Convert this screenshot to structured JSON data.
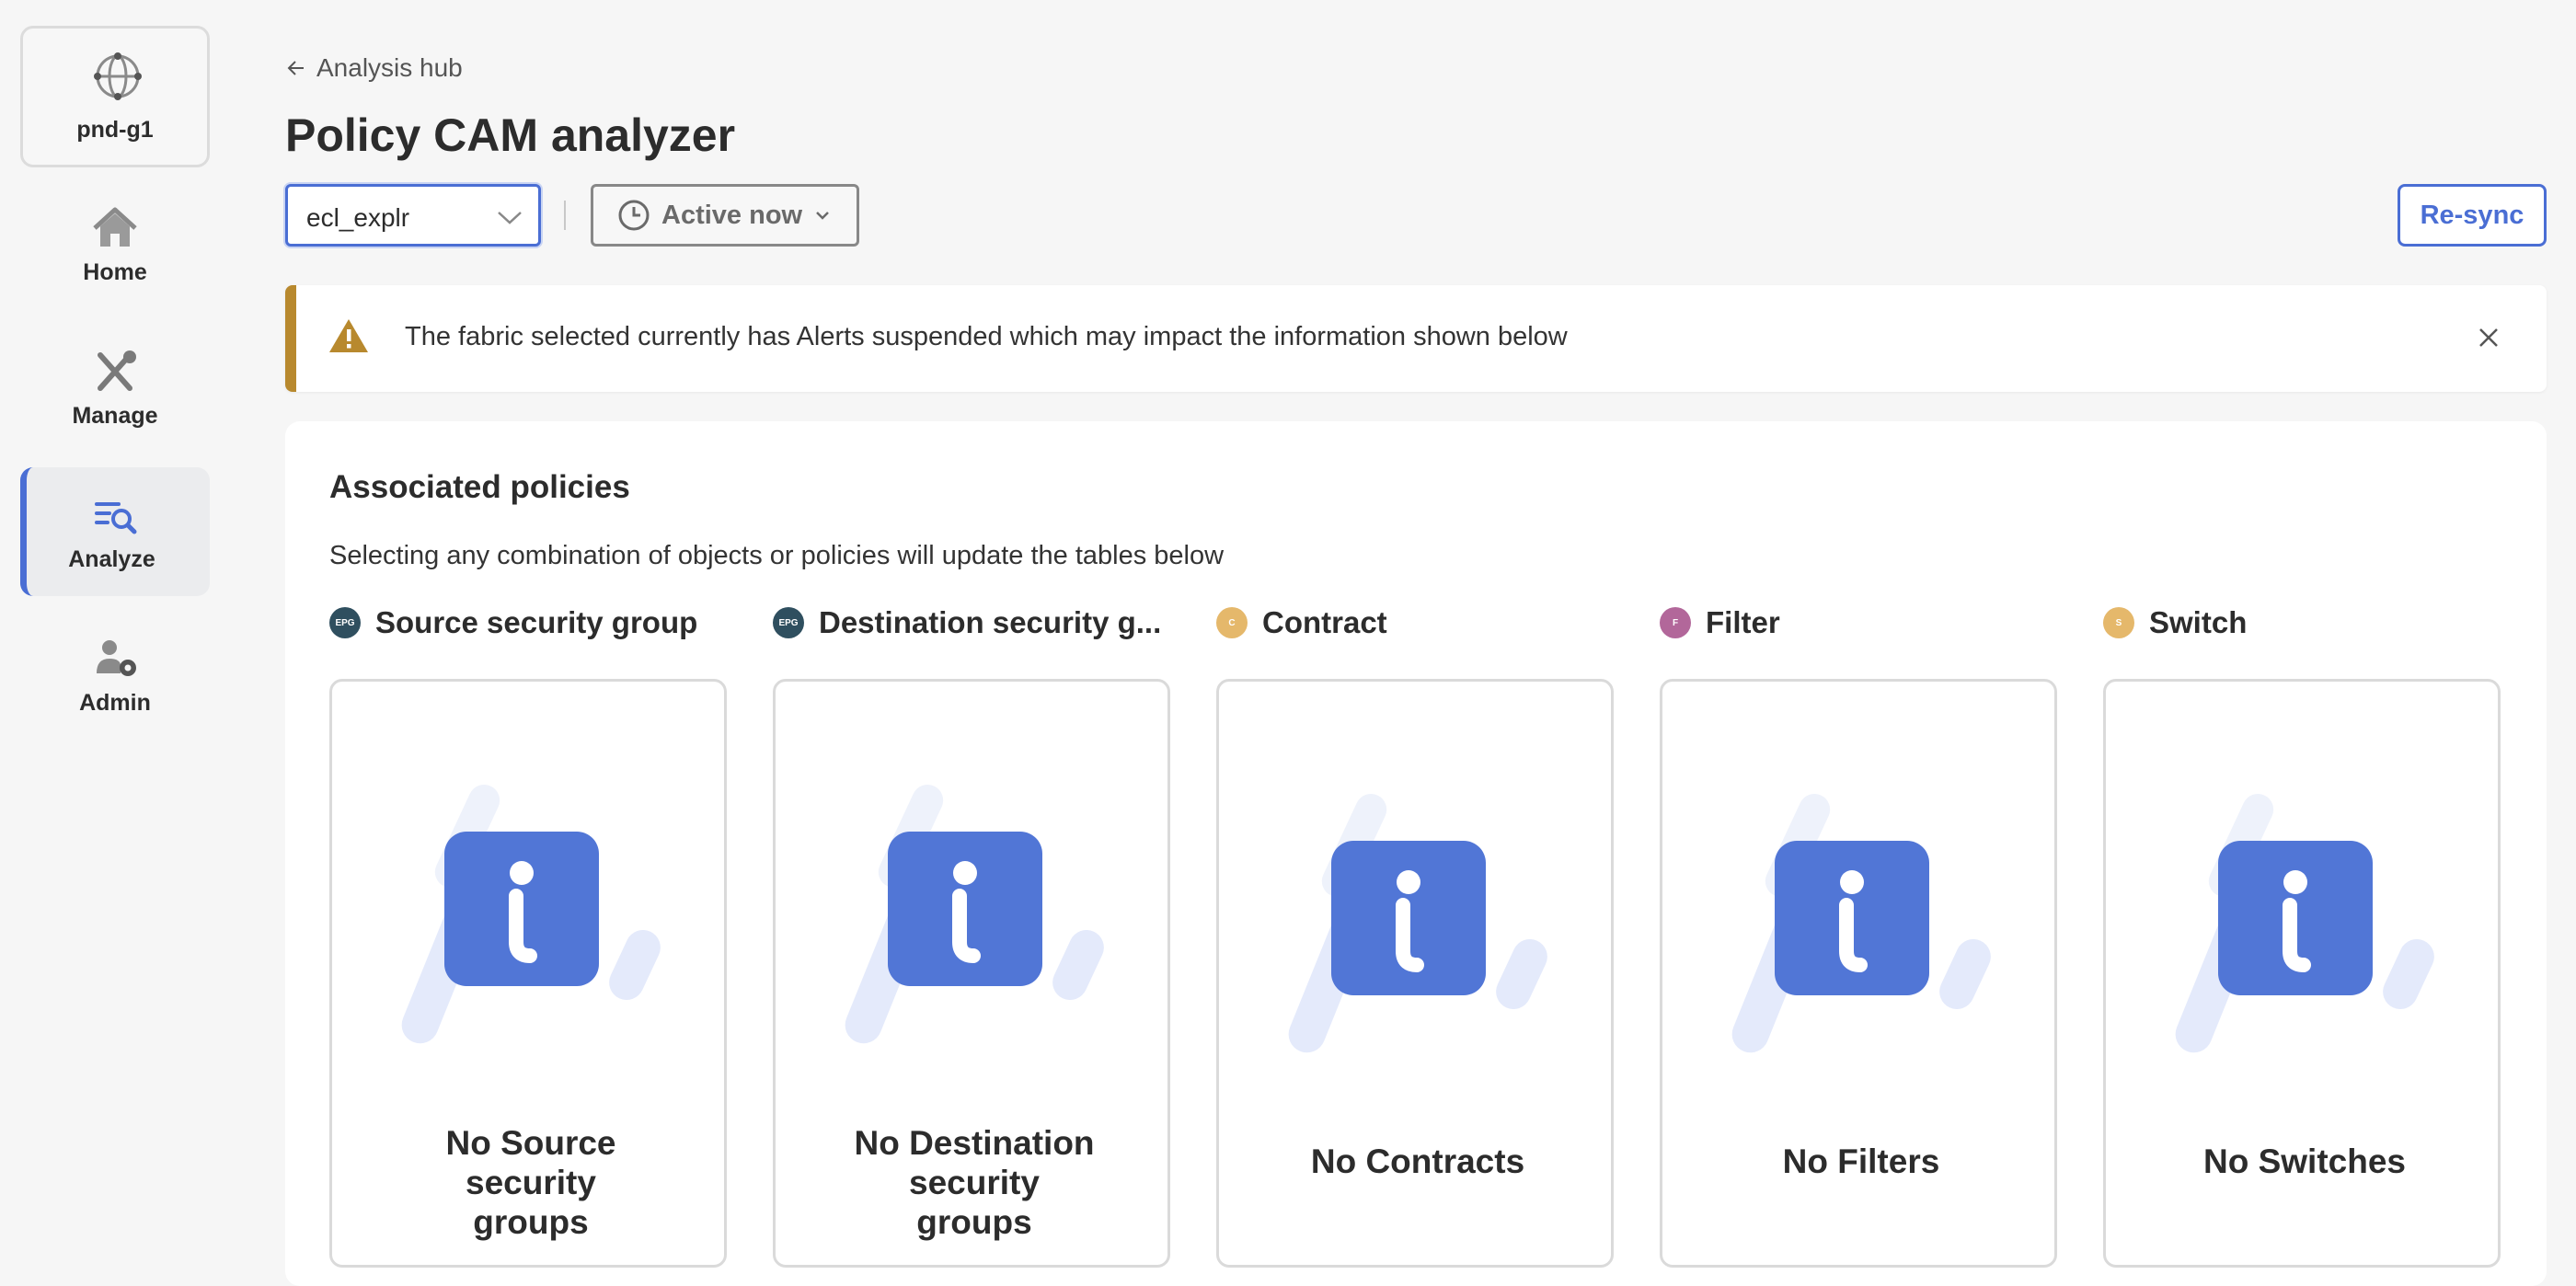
{
  "sidebar": {
    "fabric": {
      "label": "pnd-g1",
      "icon": "fabric-globe-icon"
    },
    "items": [
      {
        "label": "Home",
        "icon": "home-icon",
        "active": false
      },
      {
        "label": "Manage",
        "icon": "tools-icon",
        "active": false
      },
      {
        "label": "Analyze",
        "icon": "analyze-icon",
        "active": true
      },
      {
        "label": "Admin",
        "icon": "admin-gear-icon",
        "active": false
      }
    ],
    "active_color": "#4a6ed4"
  },
  "header": {
    "back_label": "Analysis hub",
    "title": "Policy CAM analyzer",
    "fabric_select": {
      "value": "ecl_explr"
    },
    "time_button": {
      "label": "Active now"
    },
    "resync_label": "Re-sync"
  },
  "alert": {
    "message": "The fabric selected currently has Alerts suspended which may impact the information shown below",
    "color": "#b8892e"
  },
  "policies": {
    "title": "Associated policies",
    "subtitle": "Selecting any combination of objects or policies will update the tables below",
    "columns": [
      {
        "badge": "EPG",
        "badge_color": "#2f4f5f",
        "name": "Source security group",
        "empty_lines": [
          "No Source",
          "security",
          "groups"
        ]
      },
      {
        "badge": "EPG",
        "badge_color": "#2f4f5f",
        "name": "Destination security g...",
        "empty_lines": [
          "No Destination",
          "security",
          "groups"
        ]
      },
      {
        "badge": "C",
        "badge_color": "#e5b86b",
        "name": "Contract",
        "empty_lines": [
          "No Contracts"
        ]
      },
      {
        "badge": "F",
        "badge_color": "#b2679a",
        "name": "Filter",
        "empty_lines": [
          "No Filters"
        ]
      },
      {
        "badge": "S",
        "badge_color": "#e5b86b",
        "name": "Switch",
        "empty_lines": [
          "No Switches"
        ]
      }
    ]
  }
}
